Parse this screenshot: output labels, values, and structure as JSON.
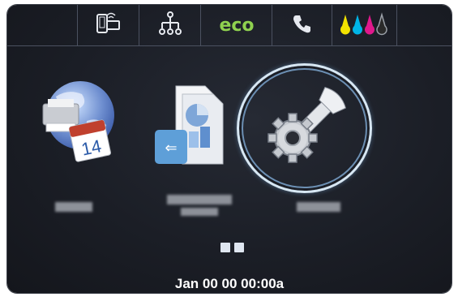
{
  "status_bar": {
    "items": [
      {
        "name": "wireless-direct-icon"
      },
      {
        "name": "network-icon"
      },
      {
        "name": "eco-button",
        "label": "eco"
      },
      {
        "name": "fax-icon"
      },
      {
        "name": "ink-levels-icon"
      }
    ],
    "colors": {
      "eco": "#8fd14f",
      "ink": [
        "#f2e200",
        "#00b4e6",
        "#e0188c",
        "#222222"
      ]
    }
  },
  "apps": [
    {
      "name": "app-web",
      "icon": "globe-calendar-icon",
      "calendar_day": "14"
    },
    {
      "name": "app-usb-print",
      "icon": "usb-document-icon"
    },
    {
      "name": "app-setup",
      "icon": "wrench-gear-icon",
      "selected": true
    }
  ],
  "pager": {
    "pages": 2
  },
  "datetime": "Jan 00 00 00:00a"
}
